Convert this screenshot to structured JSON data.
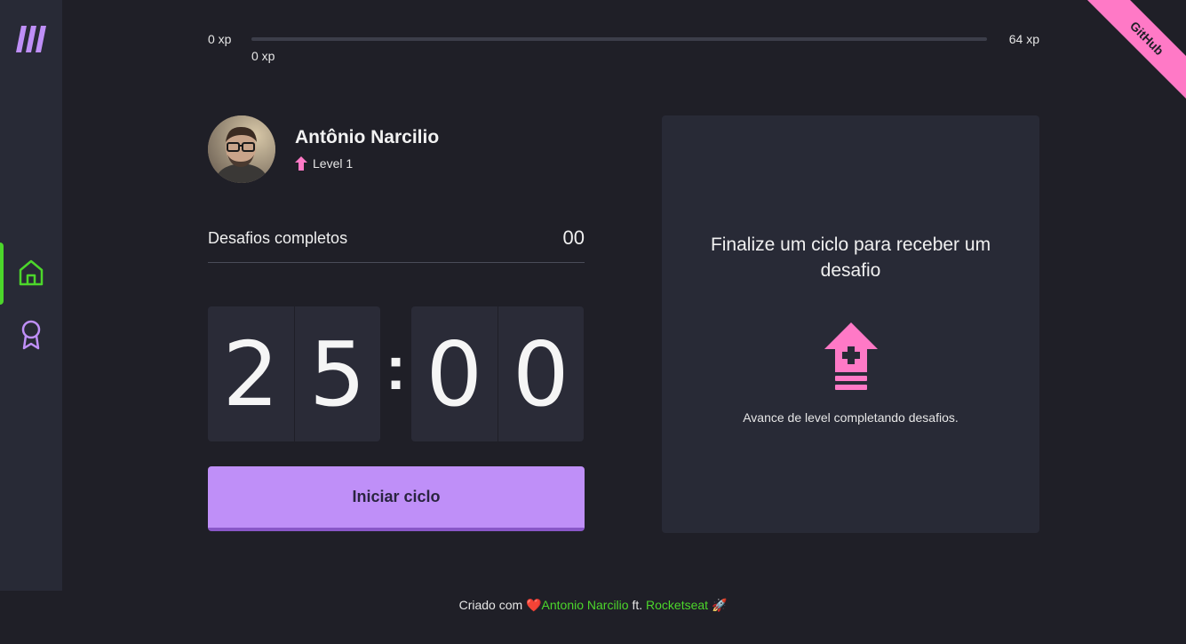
{
  "sidebar": {
    "logo_icon": "move-it-logo-icon",
    "items": [
      {
        "icon": "home-icon",
        "active": true
      },
      {
        "icon": "award-icon",
        "active": false
      }
    ]
  },
  "ribbon": {
    "label": "GitHub"
  },
  "xp": {
    "min_label": "0 xp",
    "max_label": "64 xp",
    "current_label": "0 xp",
    "progress_percent": 0
  },
  "profile": {
    "name": "Antônio Narcilio",
    "level_label": "Level 1"
  },
  "challenges": {
    "label": "Desafios completos",
    "count": "00"
  },
  "countdown": {
    "min_tens": "2",
    "min_ones": "5",
    "separator": ":",
    "sec_tens": "0",
    "sec_ones": "0"
  },
  "start_button": {
    "label": "Iniciar ciclo"
  },
  "challenge_box": {
    "title": "Finalize um ciclo para receber um desafio",
    "description": "Avance de level completando desafios.",
    "icon": "level-up-icon"
  },
  "footer": {
    "prefix": "Criado com",
    "heart": "❤️",
    "author": "Antonio Narcilio",
    "ft": "ft.",
    "partner": "Rocketseat",
    "rocket": "🚀"
  },
  "colors": {
    "background": "#1f1f27",
    "panel": "#282a36",
    "accent_green": "#4cd62b",
    "accent_purple": "#bf8ff8",
    "accent_pink": "#ff79c6"
  }
}
